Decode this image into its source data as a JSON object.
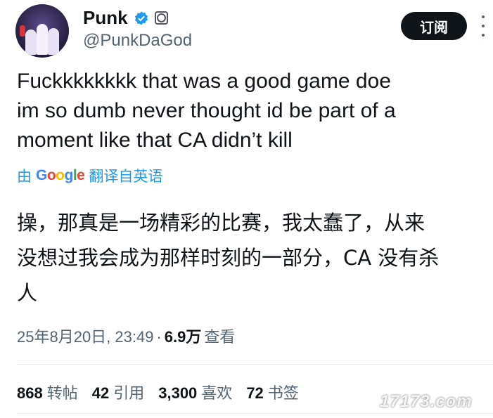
{
  "user": {
    "display_name": "Punk",
    "handle": "@PunkDaGod"
  },
  "actions": {
    "subscribe_label": "订阅"
  },
  "tweet": {
    "text_lines": [
      "Fuckkkkkkkk that was a good game doe",
      "im so dumb never thought id be part of a",
      "moment like that CA didn’t kill"
    ],
    "translate": {
      "prefix": "由",
      "google": [
        "G",
        "o",
        "o",
        "g",
        "l",
        "e"
      ],
      "suffix": "翻译自英语"
    },
    "translated_lines": [
      "操，那真是一场精彩的比赛，我太蠢了，从来",
      "没想过我会成为那样时刻的一部分，CA 没有杀",
      "人"
    ],
    "timestamp": "25年8月20日, 23:49",
    "separator": "·",
    "views_count": "6.9万",
    "views_label": "查看"
  },
  "stats": [
    {
      "count": "868",
      "label": "转帖"
    },
    {
      "count": "42",
      "label": "引用"
    },
    {
      "count": "3,300",
      "label": "喜欢"
    },
    {
      "count": "72",
      "label": "书签"
    }
  ],
  "watermark": "17173.com",
  "colors": {
    "accent": "#1d9bf0",
    "text": "#0f1419",
    "muted": "#536471"
  }
}
